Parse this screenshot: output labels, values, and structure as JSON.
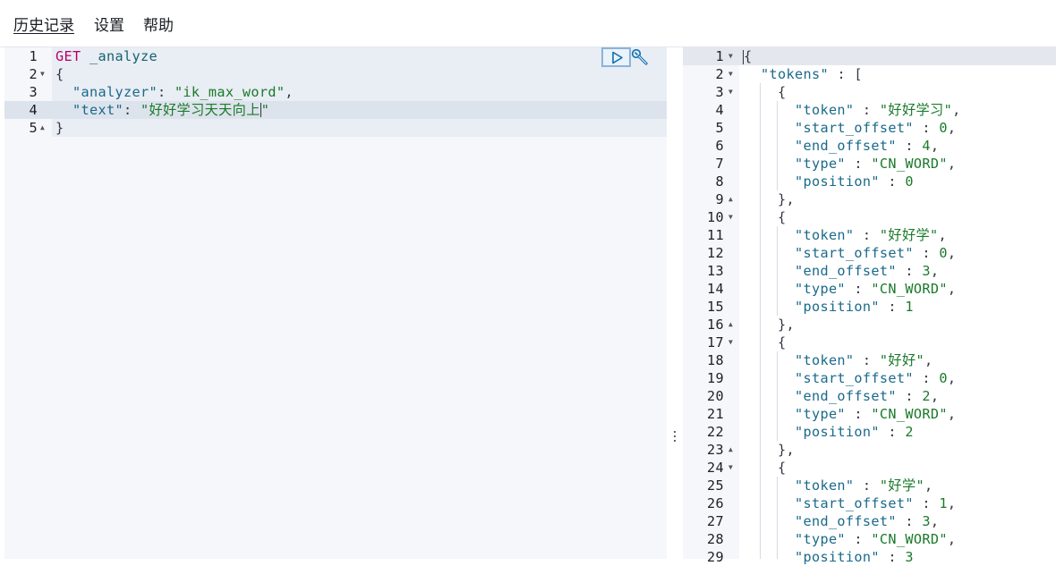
{
  "menu": {
    "history": "历史记录",
    "settings": "设置",
    "help": "帮助"
  },
  "editor": {
    "lines": [
      {
        "n": "1",
        "method": "GET",
        "path": "_analyze"
      },
      {
        "n": "2",
        "text": "{"
      },
      {
        "n": "3",
        "key": "\"analyzer\"",
        "sep": ": ",
        "value": "\"ik_max_word\"",
        "tail": ","
      },
      {
        "n": "4",
        "key": "\"text\"",
        "sep": ": ",
        "value": "\"好好学习天天向上",
        "tail": "\""
      },
      {
        "n": "5",
        "text": "}"
      }
    ]
  },
  "icons": {
    "run": "play-icon",
    "tools": "wrench-icon",
    "divider": "vertical-ellipsis-icon"
  },
  "colors": {
    "method": "#b70068",
    "string": "#1a7a2a",
    "key": "#1a6a8a",
    "run_button_border": "#8ab4d9"
  },
  "output": {
    "line_numbers": [
      "1",
      "2",
      "3",
      "4",
      "5",
      "6",
      "7",
      "8",
      "9",
      "10",
      "11",
      "12",
      "13",
      "14",
      "15",
      "16",
      "17",
      "18",
      "19",
      "20",
      "21",
      "22",
      "23",
      "24",
      "25",
      "26",
      "27",
      "28",
      "29"
    ],
    "l1": "{",
    "l2_key": "\"tokens\"",
    "l2_rest": " : [",
    "l3": "{",
    "l4_key": "\"token\"",
    "l4_sep": " : ",
    "l4_val": "\"好好学习\"",
    "l4_tail": ",",
    "l5_key": "\"start_offset\"",
    "l5_sep": " : ",
    "l5_val": "0",
    "l5_tail": ",",
    "l6_key": "\"end_offset\"",
    "l6_sep": " : ",
    "l6_val": "4",
    "l6_tail": ",",
    "l7_key": "\"type\"",
    "l7_sep": " : ",
    "l7_val": "\"CN_WORD\"",
    "l7_tail": ",",
    "l8_key": "\"position\"",
    "l8_sep": " : ",
    "l8_val": "0",
    "l9": "},",
    "l10": "{",
    "l11_key": "\"token\"",
    "l11_sep": " : ",
    "l11_val": "\"好好学\"",
    "l11_tail": ",",
    "l12_key": "\"start_offset\"",
    "l12_sep": " : ",
    "l12_val": "0",
    "l12_tail": ",",
    "l13_key": "\"end_offset\"",
    "l13_sep": " : ",
    "l13_val": "3",
    "l13_tail": ",",
    "l14_key": "\"type\"",
    "l14_sep": " : ",
    "l14_val": "\"CN_WORD\"",
    "l14_tail": ",",
    "l15_key": "\"position\"",
    "l15_sep": " : ",
    "l15_val": "1",
    "l16": "},",
    "l17": "{",
    "l18_key": "\"token\"",
    "l18_sep": " : ",
    "l18_val": "\"好好\"",
    "l18_tail": ",",
    "l19_key": "\"start_offset\"",
    "l19_sep": " : ",
    "l19_val": "0",
    "l19_tail": ",",
    "l20_key": "\"end_offset\"",
    "l20_sep": " : ",
    "l20_val": "2",
    "l20_tail": ",",
    "l21_key": "\"type\"",
    "l21_sep": " : ",
    "l21_val": "\"CN_WORD\"",
    "l21_tail": ",",
    "l22_key": "\"position\"",
    "l22_sep": " : ",
    "l22_val": "2",
    "l23": "},",
    "l24": "{",
    "l25_key": "\"token\"",
    "l25_sep": " : ",
    "l25_val": "\"好学\"",
    "l25_tail": ",",
    "l26_key": "\"start_offset\"",
    "l26_sep": " : ",
    "l26_val": "1",
    "l26_tail": ",",
    "l27_key": "\"end_offset\"",
    "l27_sep": " : ",
    "l27_val": "3",
    "l27_tail": ",",
    "l28_key": "\"type\"",
    "l28_sep": " : ",
    "l28_val": "\"CN_WORD\"",
    "l28_tail": ",",
    "l29_key": "\"position\"",
    "l29_sep": " : ",
    "l29_val": "3"
  }
}
